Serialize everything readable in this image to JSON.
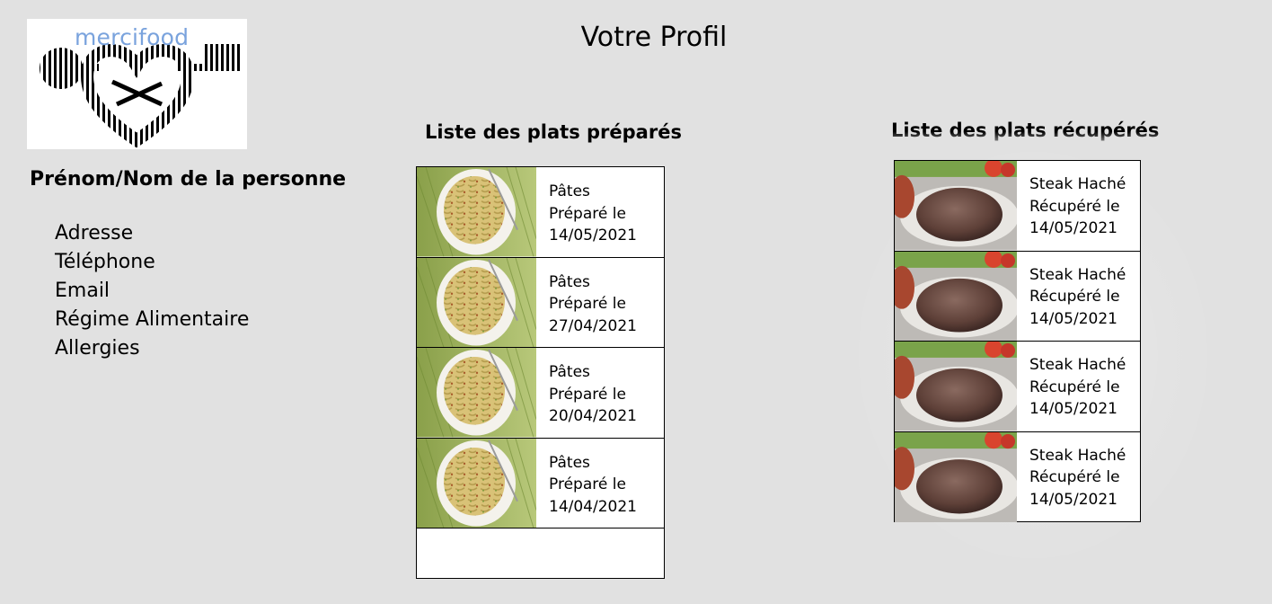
{
  "logo": {
    "text": "mercifood"
  },
  "page": {
    "title": "Votre Profil"
  },
  "profile": {
    "name": "Prénom/Nom de la personne",
    "fields": [
      "Adresse",
      "Téléphone",
      "Email",
      "Régime Alimentaire",
      "Allergies"
    ]
  },
  "prepared": {
    "title": "Liste des plats préparés",
    "items": [
      {
        "dish": "Pâtes",
        "action": "Préparé le",
        "date": "14/05/2021"
      },
      {
        "dish": "Pâtes",
        "action": "Préparé le",
        "date": "27/04/2021"
      },
      {
        "dish": "Pâtes",
        "action": "Préparé le",
        "date": "20/04/2021"
      },
      {
        "dish": "Pâtes",
        "action": "Préparé le",
        "date": "14/04/2021"
      }
    ]
  },
  "retrieved": {
    "title": "Liste des plats récupérés",
    "items": [
      {
        "dish": "Steak Haché",
        "action": "Récupéré le",
        "date": "14/05/2021"
      },
      {
        "dish": "Steak Haché",
        "action": "Récupéré le",
        "date": "14/05/2021"
      },
      {
        "dish": "Steak Haché",
        "action": "Récupéré le",
        "date": "14/05/2021"
      },
      {
        "dish": "Steak Haché",
        "action": "Récupéré le",
        "date": "14/05/2021"
      }
    ]
  },
  "icons": {
    "pasta": "pasta-plate-image",
    "steak": "steak-plate-image"
  }
}
